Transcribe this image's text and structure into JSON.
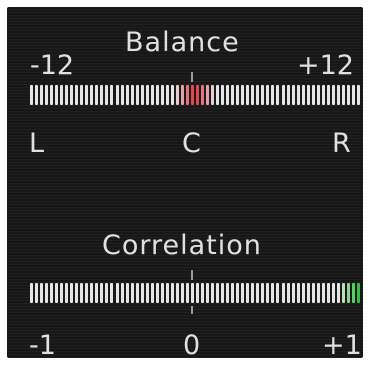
{
  "balance": {
    "title": "Balance",
    "min_label": "-12",
    "max_label": "+12",
    "left_label": "L",
    "center_label": "C",
    "right_label": "R",
    "value": 0,
    "range": [
      -12,
      12
    ],
    "indicator_color": "#e0303a"
  },
  "correlation": {
    "title": "Correlation",
    "min_label": "-1",
    "center_label": "0",
    "max_label": "+1",
    "value": 1,
    "range": [
      -1,
      1
    ],
    "indicator_color": "#2ec43a"
  },
  "colors": {
    "background": "#1c1c1c",
    "text": "#e0e0e0",
    "segment": "#e6e6e6"
  }
}
